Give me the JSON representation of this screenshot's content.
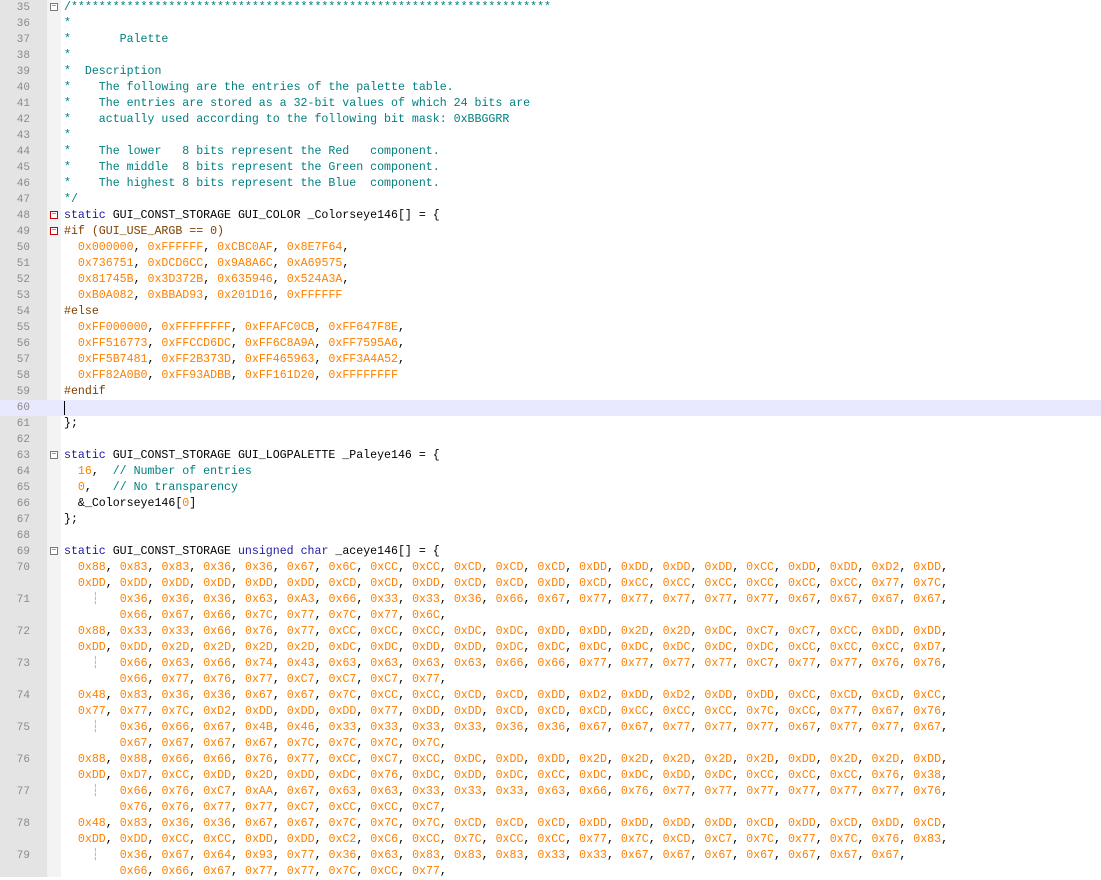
{
  "editor": {
    "lines": [
      {
        "n": "35",
        "fold": "minus",
        "segs": [
          [
            "cmt",
            "/*********************************************************************"
          ]
        ]
      },
      {
        "n": "36",
        "segs": [
          [
            "cmt",
            "*"
          ]
        ]
      },
      {
        "n": "37",
        "segs": [
          [
            "cmt",
            "*       Palette"
          ]
        ]
      },
      {
        "n": "38",
        "segs": [
          [
            "cmt",
            "*"
          ]
        ]
      },
      {
        "n": "39",
        "segs": [
          [
            "cmt",
            "*  Description"
          ]
        ]
      },
      {
        "n": "40",
        "segs": [
          [
            "cmt",
            "*    The following are the entries of the palette table."
          ]
        ]
      },
      {
        "n": "41",
        "segs": [
          [
            "cmt",
            "*    The entries are stored as a 32-bit values of which 24 bits are"
          ]
        ]
      },
      {
        "n": "42",
        "segs": [
          [
            "cmt",
            "*    actually used according to the following bit mask: 0xBBGGRR"
          ]
        ]
      },
      {
        "n": "43",
        "segs": [
          [
            "cmt",
            "*"
          ]
        ]
      },
      {
        "n": "44",
        "segs": [
          [
            "cmt",
            "*    The lower   8 bits represent the Red   component."
          ]
        ]
      },
      {
        "n": "45",
        "segs": [
          [
            "cmt",
            "*    The middle  8 bits represent the Green component."
          ]
        ]
      },
      {
        "n": "46",
        "segs": [
          [
            "cmt",
            "*    The highest 8 bits represent the Blue  component."
          ]
        ]
      },
      {
        "n": "47",
        "segs": [
          [
            "cmt",
            "*/"
          ]
        ]
      },
      {
        "n": "48",
        "fold": "minus-red",
        "segs": [
          [
            "kw",
            "static"
          ],
          [
            "txt",
            " GUI_CONST_STORAGE GUI_COLOR _Colorseye146[] = {"
          ]
        ]
      },
      {
        "n": "49",
        "fold": "minus-red",
        "segs": [
          [
            "pp",
            "#if (GUI_USE_ARGB == 0)"
          ]
        ]
      },
      {
        "n": "50",
        "segs": [
          [
            "txt",
            "  "
          ],
          [
            "num",
            "0x000000"
          ],
          [
            "txt",
            ", "
          ],
          [
            "num",
            "0xFFFFFF"
          ],
          [
            "txt",
            ", "
          ],
          [
            "num",
            "0xCBC0AF"
          ],
          [
            "txt",
            ", "
          ],
          [
            "num",
            "0x8E7F64"
          ],
          [
            "txt",
            ","
          ]
        ]
      },
      {
        "n": "51",
        "segs": [
          [
            "txt",
            "  "
          ],
          [
            "num",
            "0x736751"
          ],
          [
            "txt",
            ", "
          ],
          [
            "num",
            "0xDCD6CC"
          ],
          [
            "txt",
            ", "
          ],
          [
            "num",
            "0x9A8A6C"
          ],
          [
            "txt",
            ", "
          ],
          [
            "num",
            "0xA69575"
          ],
          [
            "txt",
            ","
          ]
        ]
      },
      {
        "n": "52",
        "segs": [
          [
            "txt",
            "  "
          ],
          [
            "num",
            "0x81745B"
          ],
          [
            "txt",
            ", "
          ],
          [
            "num",
            "0x3D372B"
          ],
          [
            "txt",
            ", "
          ],
          [
            "num",
            "0x635946"
          ],
          [
            "txt",
            ", "
          ],
          [
            "num",
            "0x524A3A"
          ],
          [
            "txt",
            ","
          ]
        ]
      },
      {
        "n": "53",
        "segs": [
          [
            "txt",
            "  "
          ],
          [
            "num",
            "0xB0A082"
          ],
          [
            "txt",
            ", "
          ],
          [
            "num",
            "0xBBAD93"
          ],
          [
            "txt",
            ", "
          ],
          [
            "num",
            "0x201D16"
          ],
          [
            "txt",
            ", "
          ],
          [
            "num",
            "0xFFFFFF"
          ]
        ]
      },
      {
        "n": "54",
        "segs": [
          [
            "pp",
            "#else"
          ]
        ]
      },
      {
        "n": "55",
        "segs": [
          [
            "txt",
            "  "
          ],
          [
            "num",
            "0xFF000000"
          ],
          [
            "txt",
            ", "
          ],
          [
            "num",
            "0xFFFFFFFF"
          ],
          [
            "txt",
            ", "
          ],
          [
            "num",
            "0xFFAFC0CB"
          ],
          [
            "txt",
            ", "
          ],
          [
            "num",
            "0xFF647F8E"
          ],
          [
            "txt",
            ","
          ]
        ]
      },
      {
        "n": "56",
        "segs": [
          [
            "txt",
            "  "
          ],
          [
            "num",
            "0xFF516773"
          ],
          [
            "txt",
            ", "
          ],
          [
            "num",
            "0xFFCCD6DC"
          ],
          [
            "txt",
            ", "
          ],
          [
            "num",
            "0xFF6C8A9A"
          ],
          [
            "txt",
            ", "
          ],
          [
            "num",
            "0xFF7595A6"
          ],
          [
            "txt",
            ","
          ]
        ]
      },
      {
        "n": "57",
        "segs": [
          [
            "txt",
            "  "
          ],
          [
            "num",
            "0xFF5B7481"
          ],
          [
            "txt",
            ", "
          ],
          [
            "num",
            "0xFF2B373D"
          ],
          [
            "txt",
            ", "
          ],
          [
            "num",
            "0xFF465963"
          ],
          [
            "txt",
            ", "
          ],
          [
            "num",
            "0xFF3A4A52"
          ],
          [
            "txt",
            ","
          ]
        ]
      },
      {
        "n": "58",
        "segs": [
          [
            "txt",
            "  "
          ],
          [
            "num",
            "0xFF82A0B0"
          ],
          [
            "txt",
            ", "
          ],
          [
            "num",
            "0xFF93ADBB"
          ],
          [
            "txt",
            ", "
          ],
          [
            "num",
            "0xFF161D20"
          ],
          [
            "txt",
            ", "
          ],
          [
            "num",
            "0xFFFFFFFF"
          ]
        ]
      },
      {
        "n": "59",
        "segs": [
          [
            "pp",
            "#endif"
          ]
        ]
      },
      {
        "n": "60",
        "active": true,
        "segs": []
      },
      {
        "n": "61",
        "segs": [
          [
            "txt",
            "};"
          ]
        ]
      },
      {
        "n": "62",
        "segs": []
      },
      {
        "n": "63",
        "fold": "minus",
        "segs": [
          [
            "kw",
            "static"
          ],
          [
            "txt",
            " GUI_CONST_STORAGE GUI_LOGPALETTE _Paleye146 = {"
          ]
        ]
      },
      {
        "n": "64",
        "segs": [
          [
            "txt",
            "  "
          ],
          [
            "num",
            "16"
          ],
          [
            "txt",
            ",  "
          ],
          [
            "cmt",
            "// Number of entries"
          ]
        ]
      },
      {
        "n": "65",
        "segs": [
          [
            "txt",
            "  "
          ],
          [
            "num",
            "0"
          ],
          [
            "txt",
            ",   "
          ],
          [
            "cmt",
            "// No transparency"
          ]
        ]
      },
      {
        "n": "66",
        "segs": [
          [
            "txt",
            "  &_Colorseye146["
          ],
          [
            "num",
            "0"
          ],
          [
            "txt",
            "]"
          ]
        ]
      },
      {
        "n": "67",
        "segs": [
          [
            "txt",
            "};"
          ]
        ]
      },
      {
        "n": "68",
        "segs": []
      },
      {
        "n": "69",
        "fold": "minus",
        "segs": [
          [
            "kw",
            "static"
          ],
          [
            "txt",
            " GUI_CONST_STORAGE "
          ],
          [
            "kw",
            "unsigned char"
          ],
          [
            "txt",
            " _aceye146[] = {"
          ]
        ]
      },
      {
        "n": "70",
        "hex": "0x88, 0x83, 0x83, 0x36, 0x36, 0x67, 0x6C, 0xCC, 0xCC, 0xCD, 0xCD, 0xCD, 0xDD, 0xDD, 0xDD, 0xDD, 0xCC, 0xDD, 0xDD, 0xD2, 0xDD,",
        "indent": "  "
      },
      {
        "n": "",
        "hex": "0xDD, 0xDD, 0xDD, 0xDD, 0xDD, 0xDD, 0xCD, 0xCD, 0xDD, 0xCD, 0xCD, 0xDD, 0xCD, 0xCC, 0xCC, 0xCC, 0xCC, 0xCC, 0xCC, 0x77, 0x7C,",
        "indent": "  "
      },
      {
        "n": "71",
        "hex": "0x36, 0x36, 0x36, 0x63, 0xA3, 0x66, 0x33, 0x33, 0x36, 0x66, 0x67, 0x77, 0x77, 0x77, 0x77, 0x77, 0x67, 0x67, 0x67, 0x67,",
        "indent": "        ",
        "wrap": true
      },
      {
        "n": "",
        "hex": "0x66, 0x67, 0x66, 0x7C, 0x77, 0x7C, 0x77, 0x6C,",
        "indent": "        "
      },
      {
        "n": "72",
        "hex": "0x88, 0x33, 0x33, 0x66, 0x76, 0x77, 0xCC, 0xCC, 0xCC, 0xDC, 0xDC, 0xDD, 0xDD, 0x2D, 0x2D, 0xDC, 0xC7, 0xC7, 0xCC, 0xDD, 0xDD,",
        "indent": "  "
      },
      {
        "n": "",
        "hex": "0xDD, 0xDD, 0x2D, 0x2D, 0x2D, 0x2D, 0xDC, 0xDC, 0xDD, 0xDD, 0xDC, 0xDC, 0xDC, 0xDC, 0xDC, 0xDC, 0xDC, 0xCC, 0xCC, 0xCC, 0xD7,",
        "indent": "  "
      },
      {
        "n": "73",
        "hex": "0x66, 0x63, 0x66, 0x74, 0x43, 0x63, 0x63, 0x63, 0x63, 0x66, 0x66, 0x77, 0x77, 0x77, 0x77, 0xC7, 0x77, 0x77, 0x76, 0x76,",
        "indent": "        ",
        "wrap": true
      },
      {
        "n": "",
        "hex": "0x66, 0x77, 0x76, 0x77, 0xC7, 0xC7, 0xC7, 0x77,",
        "indent": "        "
      },
      {
        "n": "74",
        "hex": "0x48, 0x83, 0x36, 0x36, 0x67, 0x67, 0x7C, 0xCC, 0xCC, 0xCD, 0xCD, 0xDD, 0xD2, 0xDD, 0xD2, 0xDD, 0xDD, 0xCC, 0xCD, 0xCD, 0xCC,",
        "indent": "  "
      },
      {
        "n": "",
        "hex": "0x77, 0x77, 0x7C, 0xD2, 0xDD, 0xDD, 0xDD, 0x77, 0xDD, 0xDD, 0xCD, 0xCD, 0xCD, 0xCC, 0xCC, 0xCC, 0x7C, 0xCC, 0x77, 0x67, 0x76,",
        "indent": "  "
      },
      {
        "n": "75",
        "hex": "0x36, 0x66, 0x67, 0x4B, 0x46, 0x33, 0x33, 0x33, 0x33, 0x36, 0x36, 0x67, 0x67, 0x77, 0x77, 0x77, 0x67, 0x77, 0x77, 0x67,",
        "indent": "        ",
        "wrap": true
      },
      {
        "n": "",
        "hex": "0x67, 0x67, 0x67, 0x67, 0x7C, 0x7C, 0x7C, 0x7C,",
        "indent": "        "
      },
      {
        "n": "76",
        "hex": "0x88, 0x88, 0x66, 0x66, 0x76, 0x77, 0xCC, 0xC7, 0xCC, 0xDC, 0xDD, 0xDD, 0x2D, 0x2D, 0x2D, 0x2D, 0x2D, 0xDD, 0x2D, 0x2D, 0xDD,",
        "indent": "  "
      },
      {
        "n": "",
        "hex": "0xDD, 0xD7, 0xCC, 0xDD, 0x2D, 0xDD, 0xDC, 0x76, 0xDC, 0xDD, 0xDC, 0xCC, 0xDC, 0xDC, 0xDD, 0xDC, 0xCC, 0xCC, 0xCC, 0x76, 0x38,",
        "indent": "  "
      },
      {
        "n": "77",
        "hex": "0x66, 0x76, 0xC7, 0xAA, 0x67, 0x63, 0x63, 0x33, 0x33, 0x33, 0x63, 0x66, 0x76, 0x77, 0x77, 0x77, 0x77, 0x77, 0x77, 0x76,",
        "indent": "        ",
        "wrap": true
      },
      {
        "n": "",
        "hex": "0x76, 0x76, 0x77, 0x77, 0xC7, 0xCC, 0xCC, 0xC7,",
        "indent": "        "
      },
      {
        "n": "78",
        "hex": "0x48, 0x83, 0x36, 0x36, 0x67, 0x67, 0x7C, 0x7C, 0x7C, 0xCD, 0xCD, 0xCD, 0xDD, 0xDD, 0xDD, 0xDD, 0xCD, 0xDD, 0xCD, 0xDD, 0xCD,",
        "indent": "  "
      },
      {
        "n": "",
        "hex": "0xDD, 0xDD, 0xCC, 0xCC, 0xDD, 0xDD, 0xC2, 0xC6, 0xCC, 0x7C, 0xCC, 0xCC, 0x77, 0x7C, 0xCD, 0xC7, 0x7C, 0x77, 0x7C, 0x76, 0x83,",
        "indent": "  "
      },
      {
        "n": "79",
        "hex": "0x36, 0x67, 0x64, 0x93, 0x77, 0x36, 0x63, 0x83, 0x83, 0x83, 0x33, 0x33, 0x67, 0x67, 0x67, 0x67, 0x67, 0x67, 0x67,",
        "indent": "        ",
        "wrap": true
      },
      {
        "n": "",
        "hex": "0x66, 0x66, 0x67, 0x77, 0x77, 0x7C, 0xCC, 0x77,",
        "indent": "        "
      }
    ]
  },
  "colors": {
    "comment": "#008080",
    "keyword": "#1a1aa6",
    "number": "#ff8000",
    "preprocessor": "#804000",
    "active_line": "#e8e8ff"
  }
}
